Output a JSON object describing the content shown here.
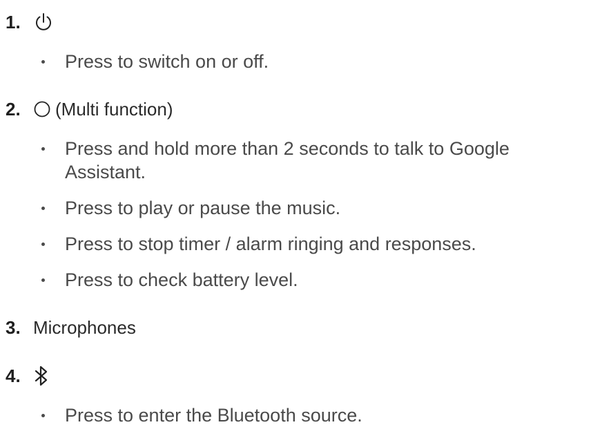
{
  "items": [
    {
      "number": "1.",
      "icon": "power-icon",
      "label": "",
      "bullets": [
        "Press to switch on or off."
      ]
    },
    {
      "number": "2.",
      "icon": "circle-icon",
      "label": "(Multi function)",
      "bullets": [
        "Press and hold more than 2 seconds to talk to Google Assistant.",
        "Press to play or pause the music.",
        "Press to stop timer / alarm ringing and responses.",
        "Press to check battery level."
      ]
    },
    {
      "number": "3.",
      "icon": "",
      "label": "Microphones",
      "bullets": []
    },
    {
      "number": "4.",
      "icon": "bluetooth-icon",
      "label": "",
      "bullets": [
        "Press to enter the Bluetooth source."
      ]
    }
  ],
  "colors": {
    "text": "#1f1f1f",
    "body_text": "#4a4a4a"
  }
}
